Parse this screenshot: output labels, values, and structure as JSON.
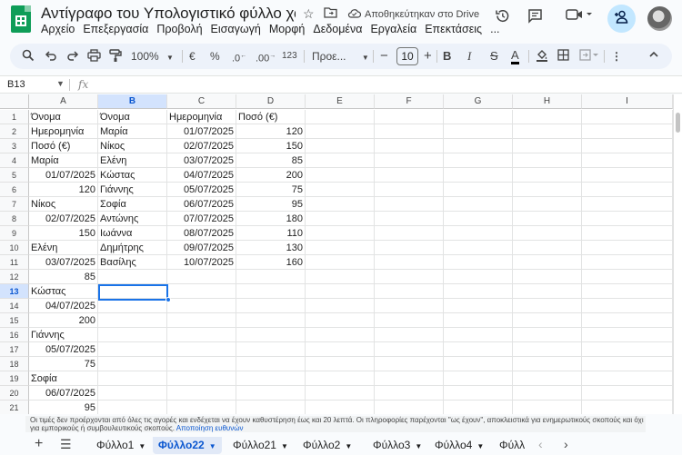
{
  "app": {
    "title": "Αντίγραφο του Υπολογιστικό φύλλο χωρίς...",
    "saved_status": "Αποθηκεύτηκαν στο Drive"
  },
  "menu": [
    "Αρχείο",
    "Επεξεργασία",
    "Προβολή",
    "Εισαγωγή",
    "Μορφή",
    "Δεδομένα",
    "Εργαλεία",
    "Επεκτάσεις",
    "..."
  ],
  "toolbar": {
    "zoom": "100%",
    "currency": "€",
    "percent": "%",
    "dec_decrease": ".0",
    "dec_increase": ".00",
    "number_format": "123",
    "font": "Προε...",
    "font_size": "10",
    "bold": "B",
    "italic": "I",
    "strike": "S",
    "text_color": "A"
  },
  "formula_bar": {
    "name_box": "B13",
    "fx": "fx"
  },
  "columns": [
    "A",
    "B",
    "C",
    "D",
    "E",
    "F",
    "G",
    "H",
    "I"
  ],
  "selected": {
    "column": "B",
    "row": 13
  },
  "rows": [
    {
      "n": "1",
      "a": "Όνομα",
      "b": "Όνομα",
      "c": "Ημερομηνία",
      "d": "Ποσό (€)"
    },
    {
      "n": "2",
      "a": "Ημερομηνία",
      "b": "Μαρία",
      "c": "01/07/2025",
      "d": "120"
    },
    {
      "n": "3",
      "a": "Ποσό (€)",
      "b": "Νίκος",
      "c": "02/07/2025",
      "d": "150"
    },
    {
      "n": "4",
      "a": "Μαρία",
      "b": "Ελένη",
      "c": "03/07/2025",
      "d": "85"
    },
    {
      "n": "5",
      "a": "01/07/2025",
      "b": "Κώστας",
      "c": "04/07/2025",
      "d": "200"
    },
    {
      "n": "6",
      "a": "120",
      "b": "Γιάννης",
      "c": "05/07/2025",
      "d": "75"
    },
    {
      "n": "7",
      "a": "Νίκος",
      "b": "Σοφία",
      "c": "06/07/2025",
      "d": "95"
    },
    {
      "n": "8",
      "a": "02/07/2025",
      "b": "Αντώνης",
      "c": "07/07/2025",
      "d": "180"
    },
    {
      "n": "9",
      "a": "150",
      "b": "Ιωάννα",
      "c": "08/07/2025",
      "d": "110"
    },
    {
      "n": "10",
      "a": "Ελένη",
      "b": "Δημήτρης",
      "c": "09/07/2025",
      "d": "130"
    },
    {
      "n": "11",
      "a": "03/07/2025",
      "b": "Βασίλης",
      "c": "10/07/2025",
      "d": "160"
    },
    {
      "n": "12",
      "a": "85",
      "b": "",
      "c": "",
      "d": ""
    },
    {
      "n": "13",
      "a": "Κώστας",
      "b": "",
      "c": "",
      "d": ""
    },
    {
      "n": "14",
      "a": "04/07/2025",
      "b": "",
      "c": "",
      "d": ""
    },
    {
      "n": "15",
      "a": "200",
      "b": "",
      "c": "",
      "d": ""
    },
    {
      "n": "16",
      "a": "Γιάννης",
      "b": "",
      "c": "",
      "d": ""
    },
    {
      "n": "17",
      "a": "05/07/2025",
      "b": "",
      "c": "",
      "d": ""
    },
    {
      "n": "18",
      "a": "75",
      "b": "",
      "c": "",
      "d": ""
    },
    {
      "n": "19",
      "a": "Σοφία",
      "b": "",
      "c": "",
      "d": ""
    },
    {
      "n": "20",
      "a": "06/07/2025",
      "b": "",
      "c": "",
      "d": ""
    },
    {
      "n": "21",
      "a": "95",
      "b": "",
      "c": "",
      "d": ""
    }
  ],
  "disclaimer": {
    "text": "Οι τιμές δεν προέρχονται από όλες τις αγορές και ενδέχεται να έχουν καθυστέρηση έως και 20 λεπτά. Οι πληροφορίες παρέχονται \"ως έχουν\", αποκλειστικά για ενημερωτικούς σκοπούς και όχι για εμπορικούς ή συμβουλευτικούς σκοπούς.",
    "link": "Αποποίηση ευθυνών"
  },
  "sheets": [
    {
      "name": "Φύλλο1",
      "active": false
    },
    {
      "name": "Φύλλο22",
      "active": true
    },
    {
      "name": "Φύλλο21",
      "active": false
    },
    {
      "name": "Φύλλο2",
      "active": false
    },
    {
      "name": "Φύλλο3",
      "active": false
    },
    {
      "name": "Φύλλο4",
      "active": false
    },
    {
      "name": "Φύλλ",
      "active": false
    }
  ],
  "colors": {
    "accent": "#1a73e8",
    "sheets_green": "#0f9d58",
    "selected_header": "#d3e3fd"
  }
}
